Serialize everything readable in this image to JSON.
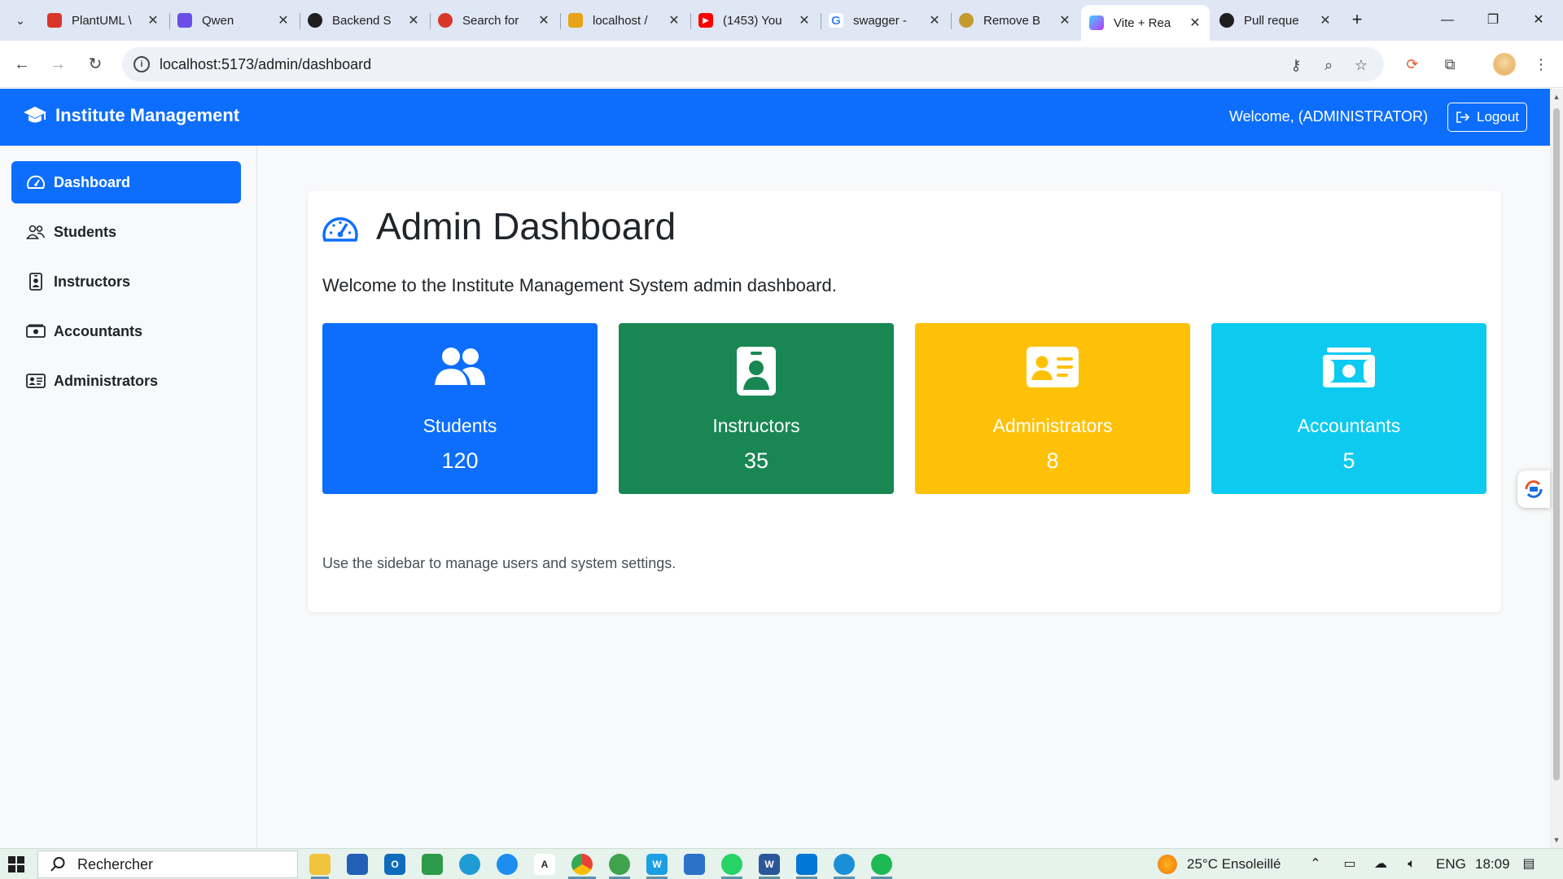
{
  "browser": {
    "tabs": [
      {
        "title": "PlantUML \\",
        "favicon": "plantuml-icon",
        "color": "#d9362b"
      },
      {
        "title": "Qwen",
        "favicon": "qwen-icon",
        "color": "#6b4ee8"
      },
      {
        "title": "Backend S",
        "favicon": "openai-icon",
        "color": "#1f1f1f"
      },
      {
        "title": "Search for",
        "favicon": "search-favicon",
        "color": "#d9362b"
      },
      {
        "title": "localhost /",
        "favicon": "phpmyadmin-icon",
        "color": "#e8a317"
      },
      {
        "title": "(1453) You",
        "favicon": "youtube-icon",
        "color": "#ff0000"
      },
      {
        "title": "swagger -",
        "favicon": "google-icon",
        "color": "#4285f4"
      },
      {
        "title": "Remove B",
        "favicon": "remove-bg-icon",
        "color": "#c59a2c"
      },
      {
        "title": "Vite + Rea",
        "favicon": "vite-icon",
        "color": "#9a5cff"
      },
      {
        "title": "Pull reque",
        "favicon": "github-icon",
        "color": "#1f1f1f"
      }
    ],
    "active_tab_index": 8,
    "url": "localhost:5173/admin/dashboard"
  },
  "app": {
    "brand": "Institute Management",
    "welcome": "Welcome, (ADMINISTRATOR)",
    "logout_label": "Logout",
    "primary_color": "#0d6efd"
  },
  "sidebar": {
    "items": [
      {
        "label": "Dashboard",
        "icon": "speedometer-icon",
        "active": true
      },
      {
        "label": "Students",
        "icon": "people-icon",
        "active": false
      },
      {
        "label": "Instructors",
        "icon": "person-badge-icon",
        "active": false
      },
      {
        "label": "Accountants",
        "icon": "cash-icon",
        "active": false
      },
      {
        "label": "Administrators",
        "icon": "person-vcard-icon",
        "active": false
      }
    ]
  },
  "main": {
    "title": "Admin Dashboard",
    "intro": "Welcome to the Institute Management System admin dashboard.",
    "stats": [
      {
        "label": "Students",
        "value": "120",
        "icon": "people-fill-icon",
        "color": "#0d6efd"
      },
      {
        "label": "Instructors",
        "value": "35",
        "icon": "person-badge-fill-icon",
        "color": "#198754"
      },
      {
        "label": "Administrators",
        "value": "8",
        "icon": "person-vcard-fill-icon",
        "color": "#ffc107"
      },
      {
        "label": "Accountants",
        "value": "5",
        "icon": "cash-stack-icon",
        "color": "#0dcaf0"
      }
    ],
    "footer_note": "Use the sidebar to manage users and system settings."
  },
  "taskbar": {
    "search_placeholder": "Rechercher",
    "weather": "25°C  Ensoleillé",
    "language": "ENG",
    "time": "18:09"
  }
}
